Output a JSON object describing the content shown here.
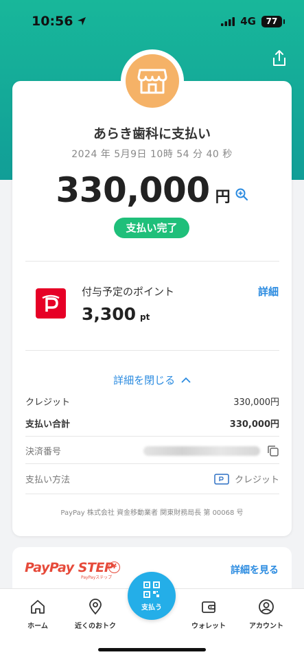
{
  "status_bar": {
    "time": "10:56",
    "network": "4G",
    "battery": "77"
  },
  "receipt": {
    "merchant": "あらき歯科に支払い",
    "datetime": "2024 年 5月9日 10時 54 分 40 秒",
    "amount": "330,000",
    "currency": "円",
    "status": "支払い完了",
    "status_color": "#1fbf7a"
  },
  "points": {
    "label": "付与予定のポイント",
    "value": "3,300",
    "unit": "pt",
    "detail_link": "詳細"
  },
  "details": {
    "toggle_label": "詳細を閉じる",
    "rows": [
      {
        "label": "クレジット",
        "value": "330,000円"
      },
      {
        "label": "支払い合計",
        "value": "330,000円"
      },
      {
        "label": "決済番号",
        "value": ""
      },
      {
        "label": "支払い方法",
        "value": "クレジット"
      }
    ],
    "footer": "PayPay 株式会社 資金移動業者 関東財務局長 第 00068 号"
  },
  "step": {
    "logo": "PayPay STEP",
    "logo_sub": "PayPayステップ",
    "link": "詳細を見る"
  },
  "nav": {
    "home": "ホーム",
    "nearby": "近くのおトク",
    "pay": "支払う",
    "wallet": "ウォレット",
    "account": "アカウント"
  },
  "colors": {
    "accent": "#2b8be0",
    "brand_red": "#e60026",
    "teal": "#18b79a",
    "pay_button": "#24aee8"
  },
  "icons": [
    "location-arrow-icon",
    "signal-icon",
    "share-icon",
    "store-icon",
    "zoom-in-icon",
    "paypay-logo-icon",
    "chevron-up-icon",
    "copy-icon",
    "credit-card-icon",
    "home-icon",
    "map-pin-icon",
    "qr-code-icon",
    "wallet-icon",
    "account-icon"
  ]
}
